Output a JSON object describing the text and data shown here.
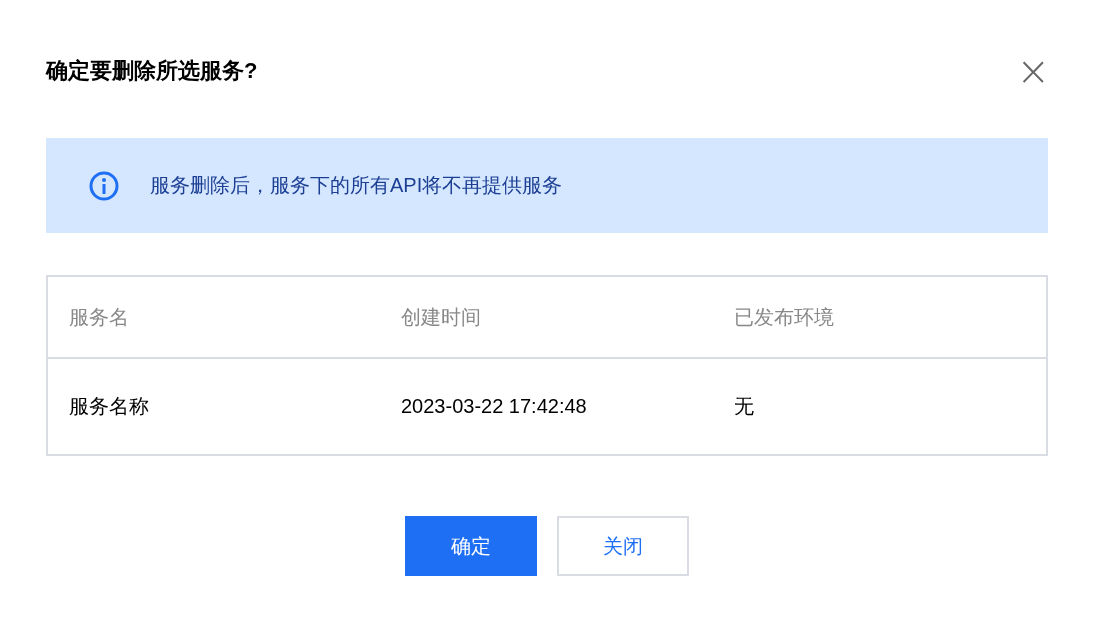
{
  "dialog": {
    "title": "确定要删除所选服务?",
    "close": "×"
  },
  "notice": {
    "text": "服务删除后，服务下的所有API将不再提供服务"
  },
  "table": {
    "columns": [
      "服务名",
      "创建时间",
      "已发布环境"
    ],
    "rows": [
      [
        "服务名称",
        "2023-03-22 17:42:48",
        "无"
      ]
    ]
  },
  "buttons": [
    {
      "label": "确定",
      "kind": "primary"
    },
    {
      "label": "关闭",
      "kind": "secondary"
    }
  ]
}
